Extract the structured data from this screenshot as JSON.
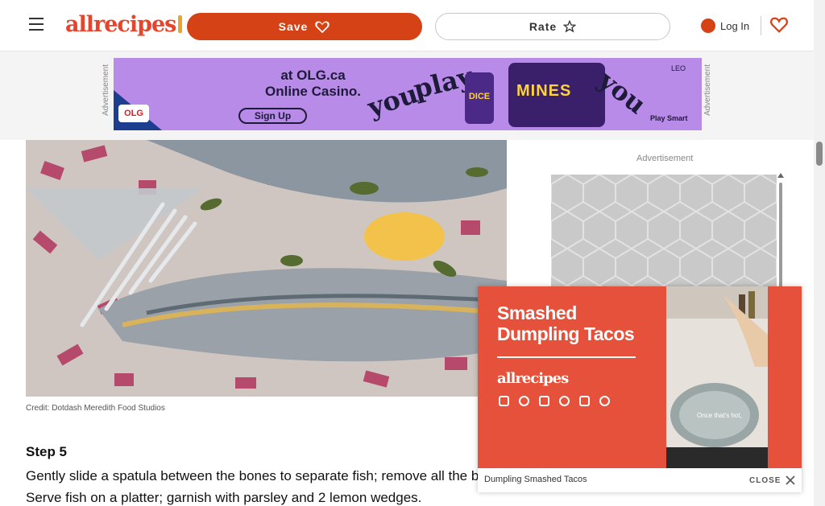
{
  "header": {
    "logo_text": "allrecipes",
    "save_label": "Save",
    "rate_label": "Rate",
    "login_label": "Log In"
  },
  "ads": {
    "side_label": "Advertisement",
    "olg": {
      "line1": "at OLG.ca",
      "line2": "Online Casino.",
      "signup": "Sign Up",
      "word_you": "you",
      "word_play": "play",
      "game": "MINES",
      "dice": "DICE",
      "corner": "LEO",
      "play_smart": "Play Smart",
      "logo": "OLG"
    },
    "right_label": "Advertisement"
  },
  "article": {
    "photo_credit": "Credit: Dotdash Meredith Food Studios",
    "step_title": "Step 5",
    "step_line1": "Gently slide a spatula between the bones to separate fish; remove all the bo",
    "step_line2": "Serve fish on a platter; garnish with parsley and 2 lemon wedges."
  },
  "video": {
    "title": "Smashed Dumpling Tacos",
    "brand": "allrecipes",
    "scene_tag": "Once that's hot,",
    "caption": "Dumpling Smashed Tacos",
    "close_label": "CLOSE"
  },
  "colors": {
    "brand_red": "#d54215",
    "ad_purple": "#b88be8",
    "video_orange": "#e5513a"
  }
}
